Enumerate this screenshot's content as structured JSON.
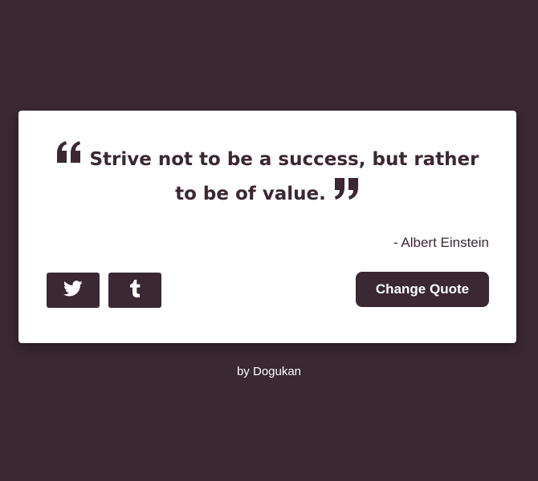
{
  "quote": {
    "text": "Strive not to be a success, but rather to be of value.",
    "author": "- Albert Einstein"
  },
  "buttons": {
    "twitter_icon": "twitter-icon",
    "tumblr_icon": "tumblr-icon",
    "change_quote_label": "Change Quote"
  },
  "footer": {
    "prefix": "by",
    "author_link": "Dogukan"
  },
  "colors": {
    "background": "#3a2832",
    "card": "#ffffff",
    "accent": "#3a2832"
  }
}
